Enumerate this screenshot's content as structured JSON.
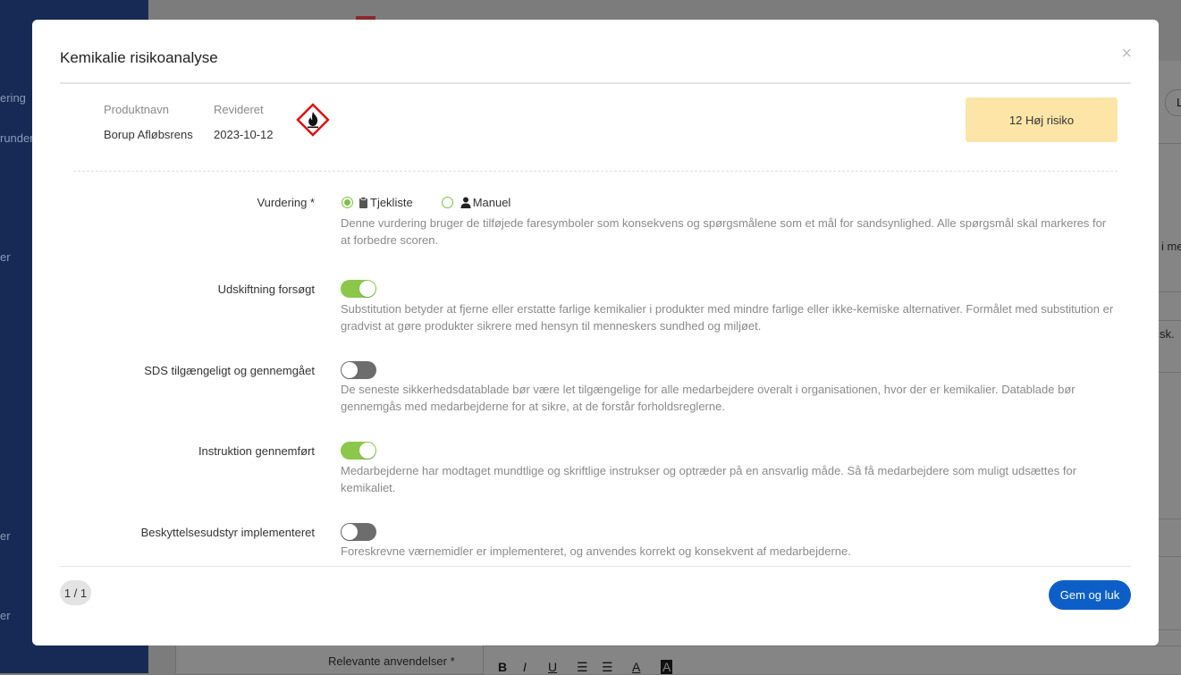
{
  "background": {
    "sidebar_fragments": [
      "ering",
      "runder",
      "er",
      "er",
      "er"
    ],
    "right_fragments": [
      "i me",
      "sk."
    ],
    "round_button_letter": "L",
    "field_label": "Relevante anvendelser *",
    "toolbar": [
      "B",
      "I",
      "U",
      "A",
      "A"
    ]
  },
  "modal": {
    "title": "Kemikalie risikoanalyse",
    "close_label": "×",
    "product": {
      "name_label": "Produktnavn",
      "name_value": "Borup Afløbsrens",
      "revised_label": "Revideret",
      "revised_value": "2023-10-12",
      "hazard_icon": "flame-hazard-icon"
    },
    "risk_badge": "12 Høj risiko",
    "risk_color": "#fde5a8",
    "assessment": {
      "label": "Vurdering *",
      "options": [
        {
          "label": "Tjekliste",
          "icon": "clipboard-icon",
          "checked": true
        },
        {
          "label": "Manuel",
          "icon": "person-icon",
          "checked": false
        }
      ],
      "description": "Denne vurdering bruger de tilføjede faresymboler som konsekvens og spørgsmålene som et mål for sandsynlighed. Alle spørgsmål skal markeres for at forbedre scoren."
    },
    "questions": [
      {
        "label": "Udskiftning forsøgt",
        "on": true,
        "description": "Substitution betyder at fjerne eller erstatte farlige kemikalier i produkter med mindre farlige eller ikke-kemiske alternativer. Formålet med substitution er gradvist at gøre produkter sikrere med hensyn til menneskers sundhed og miljøet."
      },
      {
        "label": "SDS tilgængeligt og gennemgået",
        "on": false,
        "description": "De seneste sikkerhedsdatablade bør være let tilgængelige for alle medarbejdere overalt i organisationen, hvor der er kemikalier. Datablade bør gennemgås med medarbejderne for at sikre, at de forstår forholdsreglerne."
      },
      {
        "label": "Instruktion gennemført",
        "on": true,
        "description": "Medarbejderne har modtaget mundtlige og skriftlige instrukser og optræder på en ansvarlig måde. Så få medarbejdere som muligt udsættes for kemikaliet."
      },
      {
        "label": "Beskyttelsesudstyr implementeret",
        "on": false,
        "description": "Foreskrevne værnemidler er implementeret, og anvendes korrekt og konsekvent af medarbejderne."
      }
    ],
    "pager": "1 / 1",
    "save_label": "Gem og luk",
    "accent_color": "#0d5fc7",
    "toggle_on_color": "#8bc74a"
  }
}
